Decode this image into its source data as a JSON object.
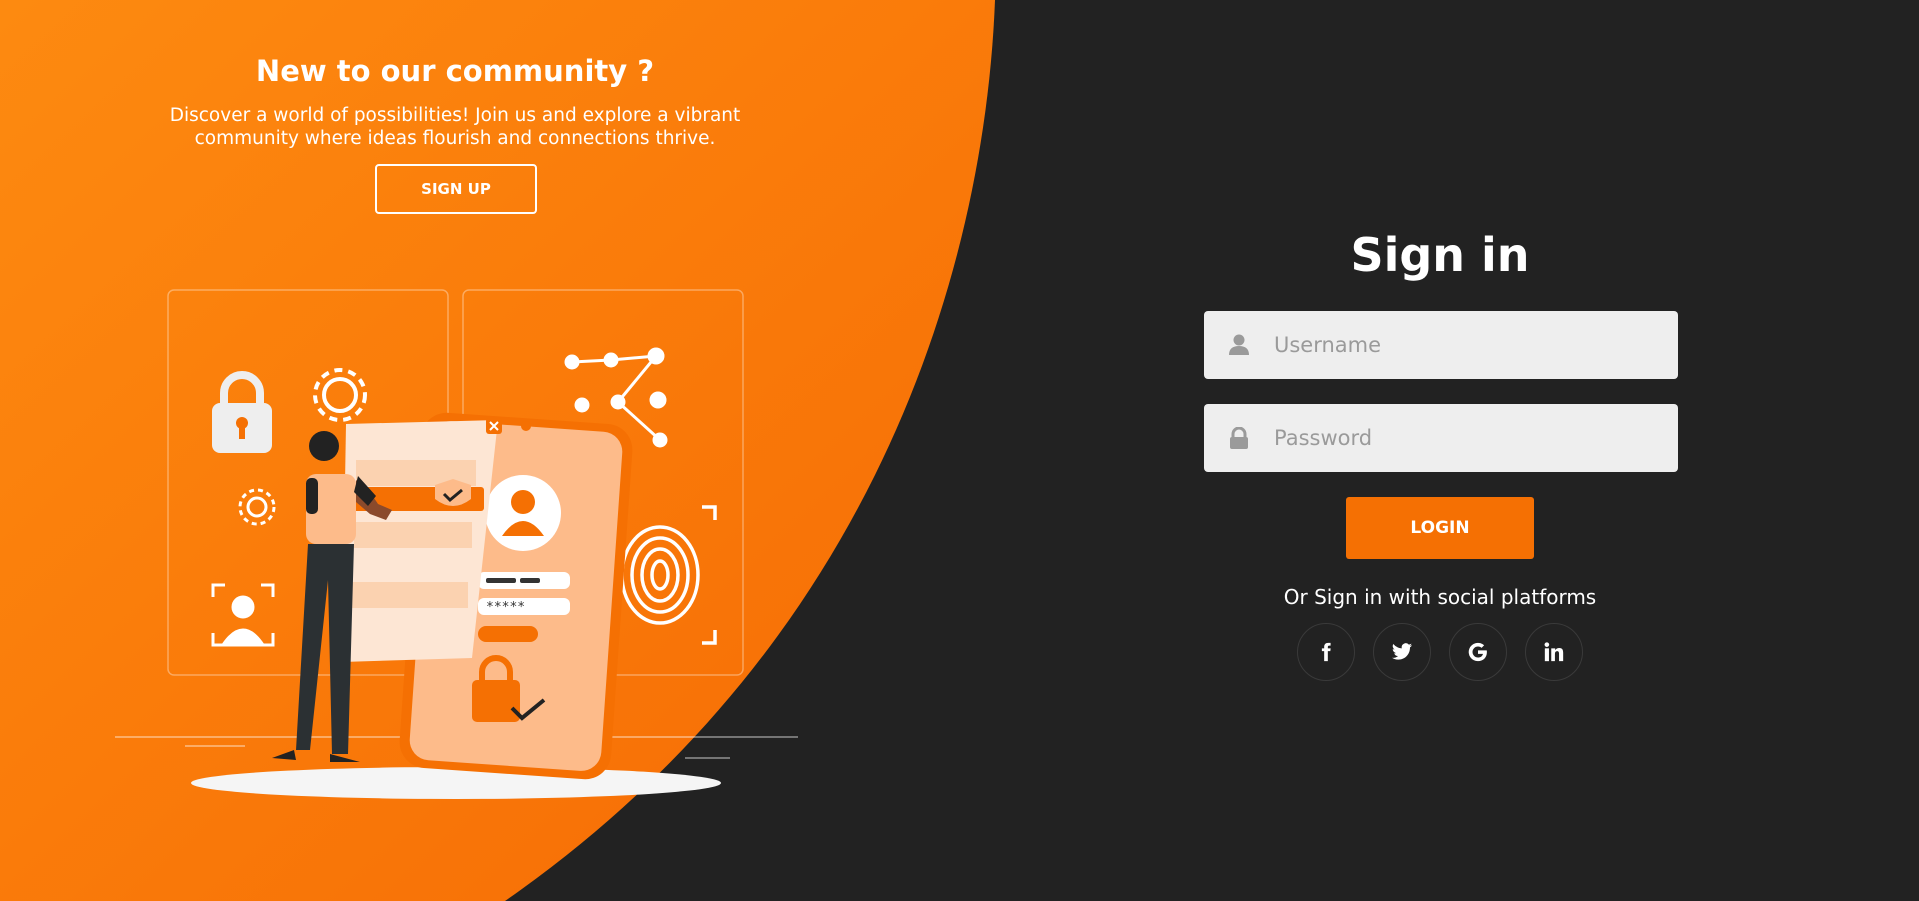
{
  "left_panel": {
    "title": "New to our community ?",
    "description": "Discover a world of possibilities! Join us and explore a vibrant community where ideas flourish and connections thrive.",
    "signup_label": "SIGN UP",
    "illustration": {
      "name": "security-login-illustration",
      "form_password_mask": "*****"
    }
  },
  "signin": {
    "title": "Sign in",
    "username": {
      "placeholder": "Username",
      "value": "",
      "icon": "user-icon"
    },
    "password": {
      "placeholder": "Password",
      "value": "",
      "icon": "lock-icon"
    },
    "login_label": "LOGIN",
    "social_text": "Or Sign in with social platforms",
    "social": [
      {
        "name": "facebook",
        "icon": "facebook-icon",
        "glyph": "f"
      },
      {
        "name": "twitter",
        "icon": "twitter-icon",
        "glyph": ""
      },
      {
        "name": "google",
        "icon": "google-icon",
        "glyph": "G"
      },
      {
        "name": "linkedin",
        "icon": "linkedin-icon",
        "glyph": "in"
      }
    ]
  },
  "colors": {
    "background_dark": "#222222",
    "accent_orange": "#f57003",
    "orange_light": "#fc8a12",
    "field_bg": "#eeeeee",
    "text_white": "#ffffff"
  }
}
